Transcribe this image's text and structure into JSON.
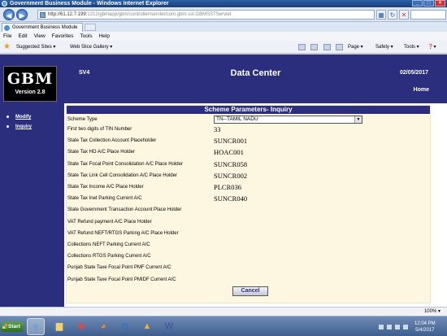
{
  "window": {
    "title": "Government Business Module - Windows Internet Explorer"
  },
  "browser": {
    "url_main": "http://61.12.7.199:",
    "url_rest": "1212/gbmapp/gbm/controller/servlet/com.gbm.sst.GBMSSTServlet",
    "tab_label": "Government Business Module",
    "menu": [
      "File",
      "Edit",
      "View",
      "Favorites",
      "Tools",
      "Help"
    ],
    "favorites": {
      "suggested": "Suggested Sites ▾",
      "webslice": "Web Slice Gallery ▾"
    },
    "command": {
      "page": "Page ▾",
      "safety": "Safety ▾",
      "tools": "Tools ▾"
    },
    "zoom": "100% ▾"
  },
  "app": {
    "logo": "GBM",
    "version": "Version 2.8",
    "sidebar": [
      {
        "label": "Modify"
      },
      {
        "label": "Inquiry"
      }
    ],
    "header": {
      "code": "SV4",
      "title": "Data Center",
      "date": "02/05/2017",
      "home": "Home"
    }
  },
  "form": {
    "title": "Scheme Parameters- Inquiry",
    "scheme_type": {
      "label": "Scheme Type",
      "value": "TN--TAMIL NADU"
    },
    "rows": [
      {
        "label": "First two digits of TIN Number",
        "value": "33"
      },
      {
        "label": "State Tax Collection Account Placeholder",
        "value": "SUNCR001"
      },
      {
        "label": "State Tax HO A/C Place Holder",
        "value": "HOAC001"
      },
      {
        "label": "State Tax Focal Point Consolidation A/C Place Holder",
        "value": "SUNCR058"
      },
      {
        "label": "State Tax Link Cell Consolidation A/C Place Holder",
        "value": "SUNCR002"
      },
      {
        "label": "State Tax Income A/C Place Holder",
        "value": "PLCR036"
      },
      {
        "label": "State Tax Inet Parking Current A/C",
        "value": "SUNCR040"
      },
      {
        "label": "State Government Transaction Account Place Holder",
        "value": ""
      },
      {
        "label": "VAT Refund payment A/C Place Holder",
        "value": ""
      },
      {
        "label": "VAT Refund NEFT/RTGS Parking A/C Place Holder",
        "value": ""
      },
      {
        "label": "Collections NEFT Parking Current A/C",
        "value": ""
      },
      {
        "label": "Collections RTGS Parking Current A/C",
        "value": ""
      },
      {
        "label": "Punjab State Taxe Focal Point PMF Current A/C",
        "value": ""
      },
      {
        "label": "Punjab State Taxe Focal Point PMIDF Current A/C",
        "value": ""
      }
    ],
    "cancel_label": "Cancel"
  },
  "taskbar": {
    "start": "Start",
    "time": "12:04 PM",
    "date": "5/4/2017"
  }
}
